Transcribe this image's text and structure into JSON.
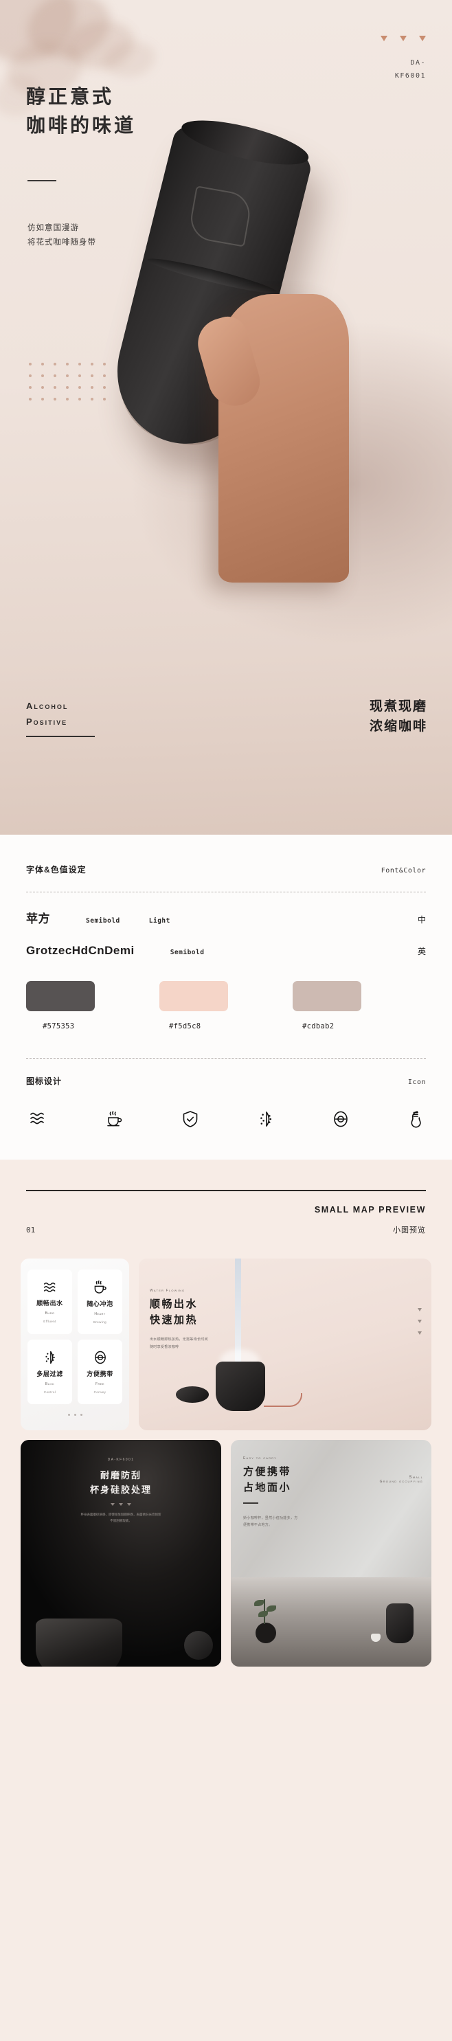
{
  "hero": {
    "title_line1": "醇正意式",
    "title_line2": "咖啡的味道",
    "sub_line1": "仿如意国漫游",
    "sub_line2": "将花式咖啡随身带",
    "code_line1": "DA-",
    "code_line2": "KF6001",
    "badge_line1": "Alcohol",
    "badge_line2": "Positive",
    "right_line1": "现煮现磨",
    "right_line2": "浓缩咖啡"
  },
  "specs": {
    "section_title_cn": "字体&色值设定",
    "section_title_en": "Font&Color",
    "fonts": [
      {
        "name": "苹方",
        "weight1": "Semibold",
        "weight2": "Light",
        "lang": "中"
      },
      {
        "name": "GrotzecHdCnDemi",
        "weight1": "Semibold",
        "weight2": "",
        "lang": "英"
      }
    ],
    "colors": [
      {
        "hex": "#575353"
      },
      {
        "hex": "#f5d5c8"
      },
      {
        "hex": "#cdbab2"
      }
    ],
    "icon_title_cn": "图标设计",
    "icon_title_en": "Icon",
    "icons": [
      "waves-icon",
      "coffee-cup-icon",
      "shield-check-icon",
      "filter-dots-icon",
      "oval-minus-icon",
      "bulb-icon"
    ]
  },
  "preview": {
    "title_en": "SMALL MAP PREVIEW",
    "number": "01",
    "title_cn": "小图预览",
    "features": [
      {
        "icon": "waves-icon",
        "title": "顺畅出水",
        "sub1": "Buro",
        "sub2": "Effluent"
      },
      {
        "icon": "coffee-cup-icon",
        "title": "随心冲泡",
        "sub1": "Heart",
        "sub2": "Brewing"
      },
      {
        "icon": "filter-dots-icon",
        "title": "多层过滤",
        "sub1": "Bloc",
        "sub2": "Control"
      },
      {
        "icon": "oval-minus-icon",
        "title": "方便携带",
        "sub1": "Free",
        "sub2": "Convey"
      }
    ],
    "card_water": {
      "en": "Water Flowing",
      "h1": "顺畅出水",
      "h2": "快速加热",
      "body1": "出水顺畅即热加热，无需等待长时间",
      "body2": "随时享受香浓咖啡"
    },
    "card_black": {
      "en": "DA-KF6001",
      "h1": "耐磨防刮",
      "h2": "杯身硅胶处理",
      "body1": "杯身表面磨砂质感，即使发生刮蹭摔跌，表面依旧光亮如新",
      "body2": "不留刮痕瑕疵。"
    },
    "card_silver": {
      "en": "Easy to carry",
      "h1": "方便携带",
      "h2": "占地面小",
      "side1": "Small",
      "side2": "Ground occupying",
      "body1": "娇小咖啡杯，虽然小但功能多，方",
      "body2": "便携带不占地方。"
    }
  }
}
